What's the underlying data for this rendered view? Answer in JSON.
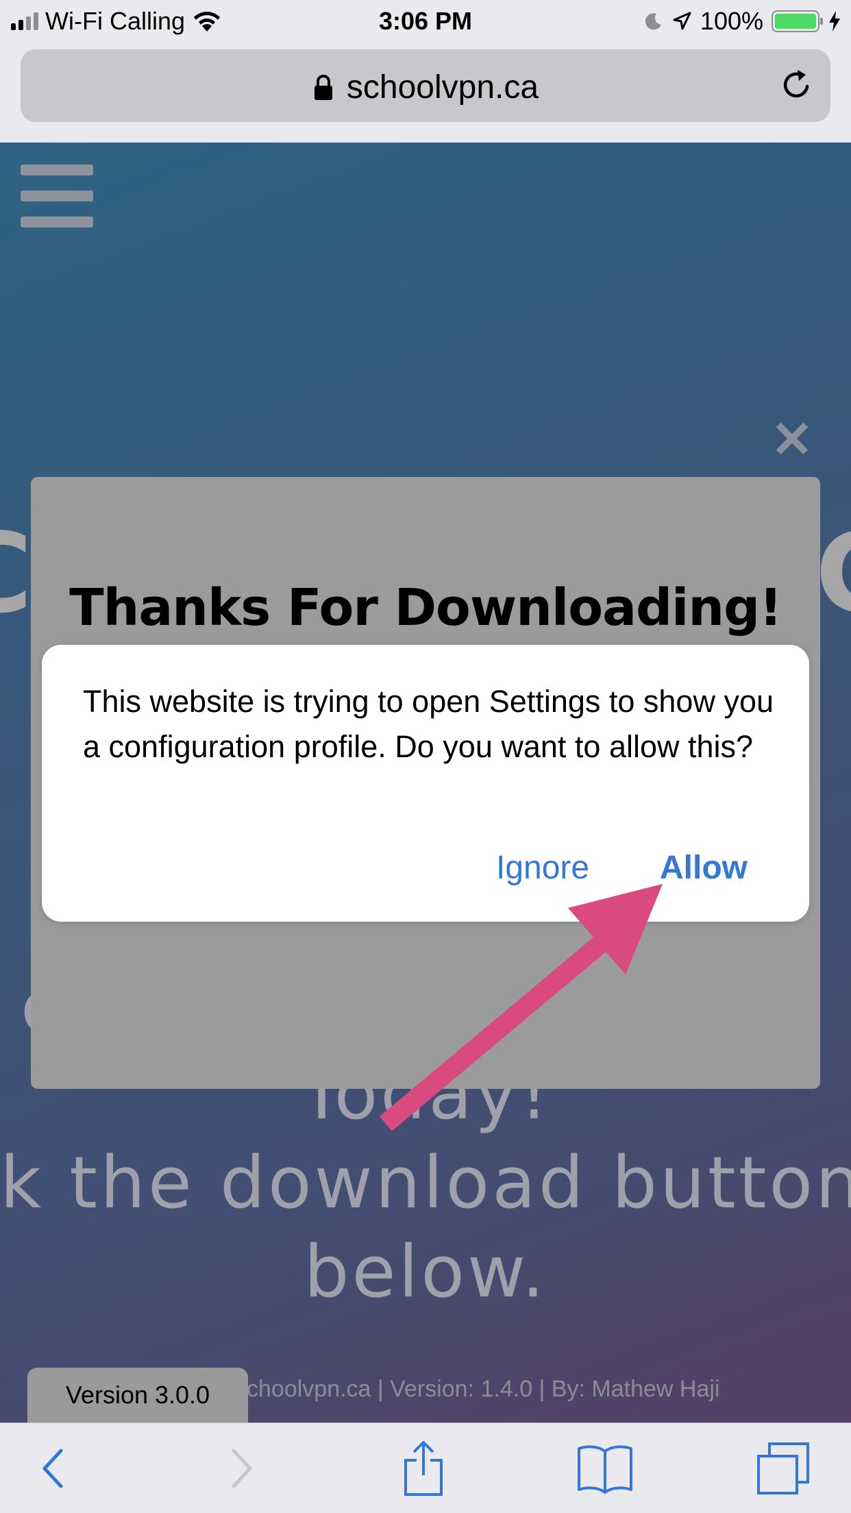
{
  "status_bar": {
    "carrier": "Wi-Fi Calling",
    "time": "3:06 PM",
    "battery": "100%"
  },
  "browser": {
    "url": "schoolvpn.ca"
  },
  "page": {
    "modal_title": "Thanks For Downloading!",
    "background_line_1": "l                               ch",
    "background_line_2": "Today!",
    "background_line_3": "k the download button d",
    "background_line_4": "below.",
    "edge_left_glyph": "C",
    "edge_right_glyph": "C",
    "close_glyph": "✕",
    "footer": "choolvpn.ca | Version: 1.4.0 | By: Mathew Haji",
    "version_tab": "Version 3.0.0"
  },
  "alert": {
    "message": "This website is trying to open Settings to show you a configuration profile. Do you want to allow this?",
    "ignore_label": "Ignore",
    "allow_label": "Allow"
  },
  "colors": {
    "accent": "#3478d6",
    "arrow": "#d94a7e",
    "battery": "#4cd964"
  }
}
